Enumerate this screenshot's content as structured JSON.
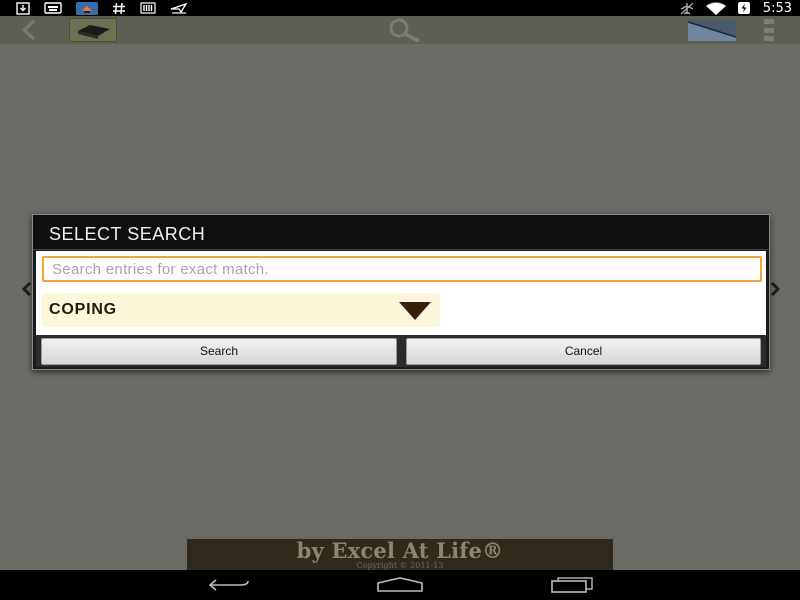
{
  "status_bar": {
    "time": "5:53",
    "left_icons": [
      "download-icon",
      "keyboard-icon",
      "app-notification-icon",
      "hashtag-icon",
      "barcode-icon",
      "flight-icon"
    ],
    "right_icons": [
      "airplane-mode-icon",
      "wifi-icon",
      "battery-charging-icon"
    ]
  },
  "action_bar": {
    "icons": [
      "back-arrow-icon",
      "app-logo-icon",
      "search-icon",
      "chart-icon",
      "overflow-menu-icon"
    ]
  },
  "dialog": {
    "title": "SELECT SEARCH",
    "search_field": {
      "placeholder": "Search entries for exact match.",
      "value": ""
    },
    "category_spinner": {
      "selected": "COPING"
    },
    "buttons": {
      "search": "Search",
      "cancel": "Cancel"
    }
  },
  "banner": {
    "text": "by Excel At Life®",
    "copyright": "Copyright © 2011-13"
  },
  "nav_bar": {
    "icons": [
      "nav-back-icon",
      "nav-home-icon",
      "nav-recent-apps-icon"
    ]
  },
  "colors": {
    "accent_border": "#f2a33a",
    "spinner_background": "#fbf7d8",
    "dim_overlay": "#6b6b66"
  }
}
